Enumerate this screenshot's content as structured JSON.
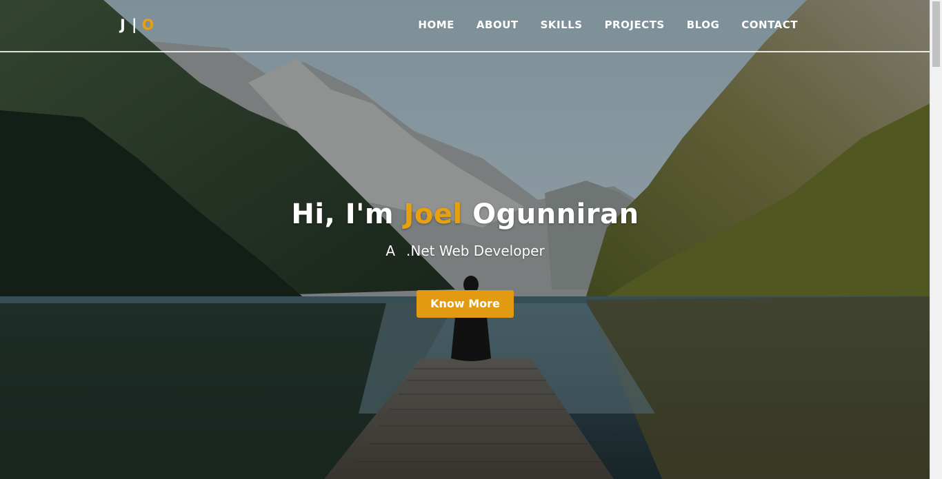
{
  "brand": {
    "initial_first": "J",
    "separator": "|",
    "initial_last": "O"
  },
  "nav": {
    "items": [
      {
        "label": "HOME"
      },
      {
        "label": "ABOUT"
      },
      {
        "label": "SKILLS"
      },
      {
        "label": "PROJECTS"
      },
      {
        "label": "BLOG"
      },
      {
        "label": "CONTACT"
      }
    ]
  },
  "hero": {
    "greeting": "Hi, I'm",
    "first_name": "Joel",
    "last_name": "Ogunniran",
    "subtitle_prefix": "A",
    "subtitle_role": ".Net Web Developer",
    "cta_label": "Know More",
    "background_description": "mountain-lake-with-wooden-pier"
  },
  "colors": {
    "accent": "#e8a00e",
    "button": "#e19a12",
    "text": "#ffffff"
  }
}
